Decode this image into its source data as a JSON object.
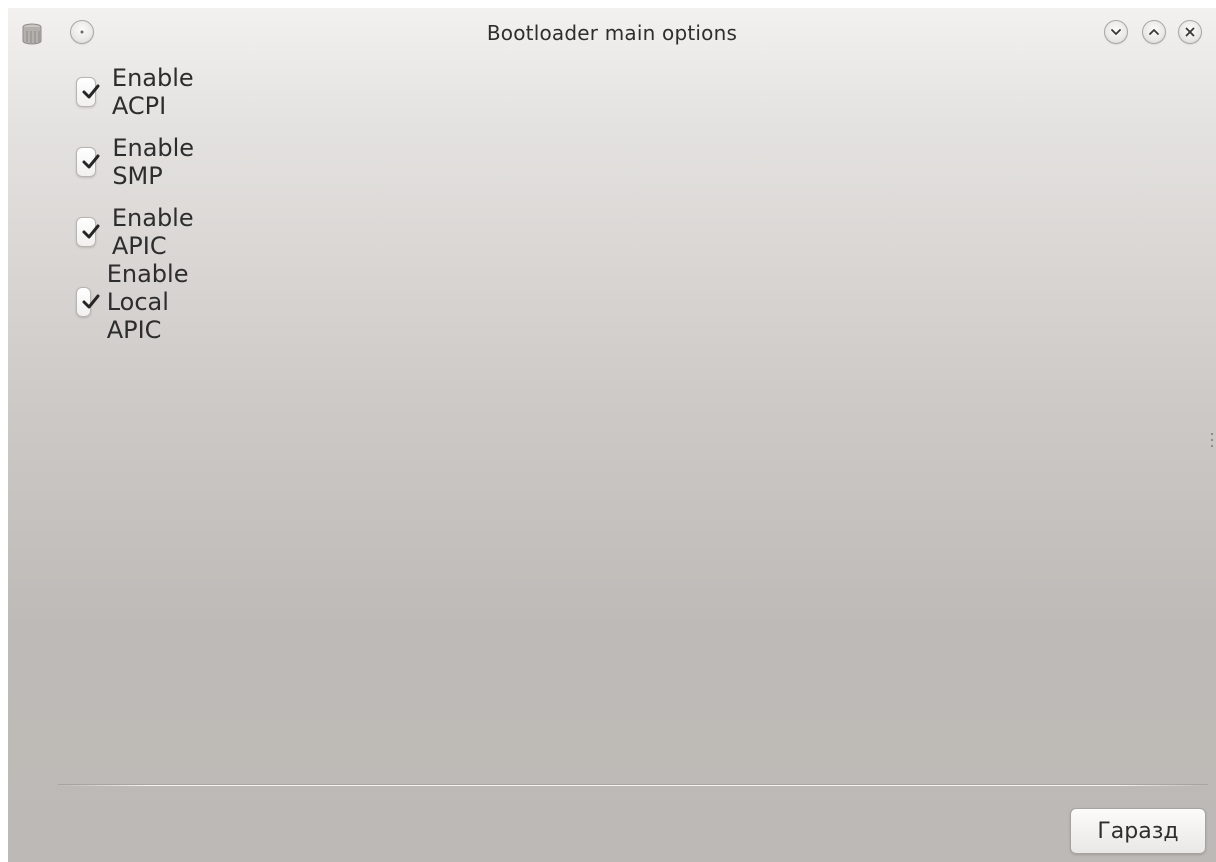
{
  "window": {
    "title": "Bootloader main options"
  },
  "titlebar": {
    "app_icon": "disk-drive-icon",
    "menu_button_icon": "dot-circle-icon",
    "minimize_icon": "chevron-down-icon",
    "maximize_icon": "chevron-up-icon",
    "close_icon": "close-icon"
  },
  "options": [
    {
      "label": "Enable ACPI",
      "checked": true
    },
    {
      "label": "Enable SMP",
      "checked": true
    },
    {
      "label": "Enable APIC",
      "checked": true
    },
    {
      "label": "Enable Local APIC",
      "checked": true
    }
  ],
  "footer": {
    "ok_label": "Гаразд"
  }
}
